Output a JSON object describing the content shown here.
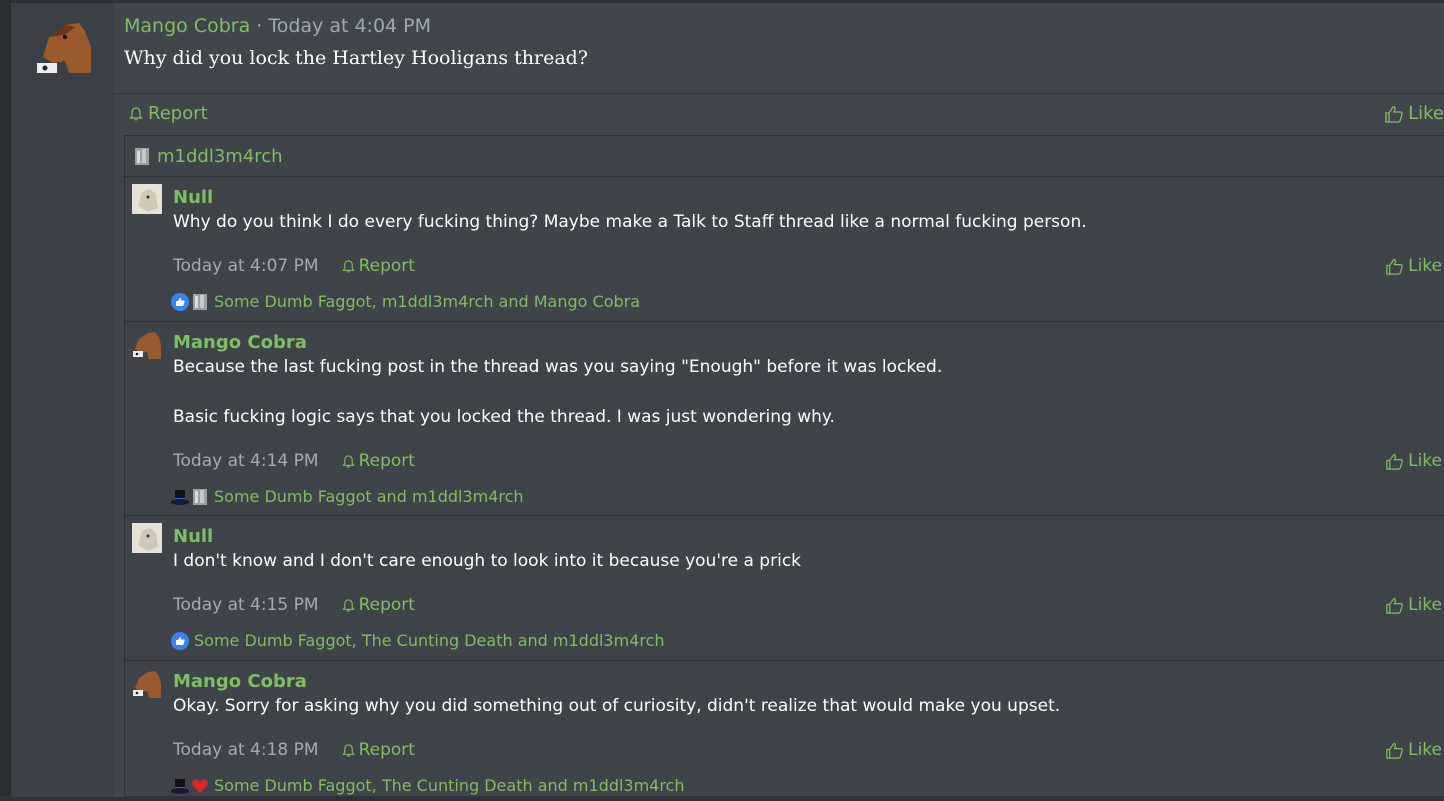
{
  "post": {
    "author": "Mango Cobra",
    "separator": " · ",
    "time": "Today at 4:04 PM",
    "body": "Why did you lock the Hartley Hooligans thread?",
    "report_label": "Report",
    "like_label": "Like"
  },
  "comments_header": {
    "user": "m1ddl3m4rch"
  },
  "comments": [
    {
      "author": "Null",
      "lines": [
        "Why do you think I do every fucking thing? Maybe make a Talk to Staff thread like a normal fucking person."
      ],
      "time": "Today at 4:07 PM",
      "report_label": "Report",
      "like_label": "Like",
      "reactions_text": "Some Dumb Faggot, m1ddl3m4rch and Mango Cobra",
      "reaction_icons": [
        "thumbs-up",
        "gray-figure"
      ]
    },
    {
      "author": "Mango Cobra",
      "lines": [
        "Because the last fucking post in the thread was you saying \"Enough\" before it was locked.",
        "Basic fucking logic says that you locked the thread. I was just wondering why."
      ],
      "time": "Today at 4:14 PM",
      "report_label": "Report",
      "like_label": "Like",
      "reactions_text": "Some Dumb Faggot and m1ddl3m4rch",
      "reaction_icons": [
        "top-hat",
        "gray-figure"
      ]
    },
    {
      "author": "Null",
      "lines": [
        "I don't know and I don't care enough to look into it because you're a prick"
      ],
      "time": "Today at 4:15 PM",
      "report_label": "Report",
      "like_label": "Like",
      "reactions_text": "Some Dumb Faggot, The Cunting Death and m1ddl3m4rch",
      "reaction_icons": [
        "thumbs-up"
      ]
    },
    {
      "author": "Mango Cobra",
      "lines": [
        "Okay. Sorry for asking why you did something out of curiosity, didn't realize that would make you upset."
      ],
      "time": "Today at 4:18 PM",
      "report_label": "Report",
      "like_label": "Like",
      "reactions_text": "Some Dumb Faggot, The Cunting Death and m1ddl3m4rch",
      "reaction_icons": [
        "top-hat",
        "red-heart"
      ]
    }
  ],
  "colors": {
    "accent": "#7fbf5f",
    "background": "#41454c",
    "text": "#ffffff",
    "muted": "#a4abb2"
  }
}
